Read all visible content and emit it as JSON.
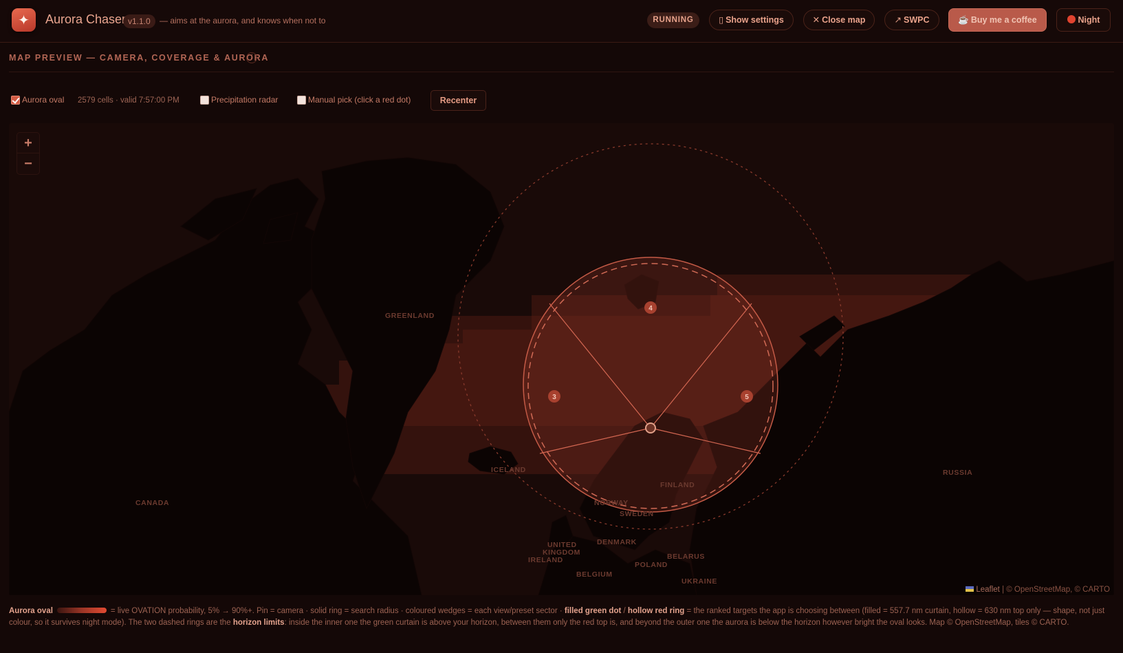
{
  "header": {
    "logo_icon": "sparkle-icon",
    "title": "Aurora Chaser",
    "version": "v1.1.0",
    "tagline": "— aims at the aurora, and knows when not to",
    "status": "RUNNING",
    "buttons": {
      "settings": "Show settings",
      "close_map": "Close map",
      "swpc": "SWPC",
      "coffee": "Buy me a coffee",
      "theme": "Night"
    }
  },
  "section": {
    "title": "MAP PREVIEW — CAMERA, COVERAGE & AURORA",
    "info_icon": "i"
  },
  "controls": {
    "aurora_oval": {
      "label": "Aurora oval",
      "checked": true
    },
    "cells_info": "2579 cells · valid 7:57:00 PM",
    "precipitation": {
      "label": "Precipitation radar",
      "checked": false
    },
    "manual_pick": {
      "label": "Manual pick (click a red dot)",
      "checked": false
    },
    "recenter": "Recenter"
  },
  "map": {
    "zoom_in": "+",
    "zoom_out": "−",
    "labels": {
      "greenland": "GREENLAND",
      "canada": "CANADA",
      "iceland": "ICELAND",
      "norway": "NORWAY",
      "sweden": "SWEDEN",
      "finland": "FINLAND",
      "russia": "RUSSIA",
      "uk1": "UNITED",
      "uk2": "KINGDOM",
      "ireland": "IRELAND",
      "denmark": "DENMARK",
      "poland": "POLAND",
      "belarus": "BELARUS",
      "belgium": "BELGIUM",
      "ukraine": "UKRAINE"
    },
    "sectors": [
      "3",
      "4",
      "5"
    ],
    "attribution_leaflet": "Leaflet",
    "attribution_rest": "| © OpenStreetMap, © CARTO",
    "colors": {
      "accent": "#d35b44",
      "background": "#140807"
    }
  },
  "legend": {
    "oval_label": "Aurora oval",
    "text1": "= live OVATION probability, 5% → 90%+. Pin = camera · solid ring = search radius · coloured wedges = each view/preset sector ·",
    "filled": "filled green dot",
    "slash": "/",
    "hollow": "hollow red ring",
    "text2": "= the ranked targets the app is choosing between (filled = 557.7 nm curtain, hollow = 630 nm top only — shape, not just colour, so it survives night mode). The two dashed rings are the",
    "horizon": "horizon limits",
    "text3": ": inside the inner one the green curtain is above your horizon, between them only the red top is, and beyond the outer one the aurora is below the horizon however bright the oval looks. Map © OpenStreetMap, tiles © CARTO."
  }
}
